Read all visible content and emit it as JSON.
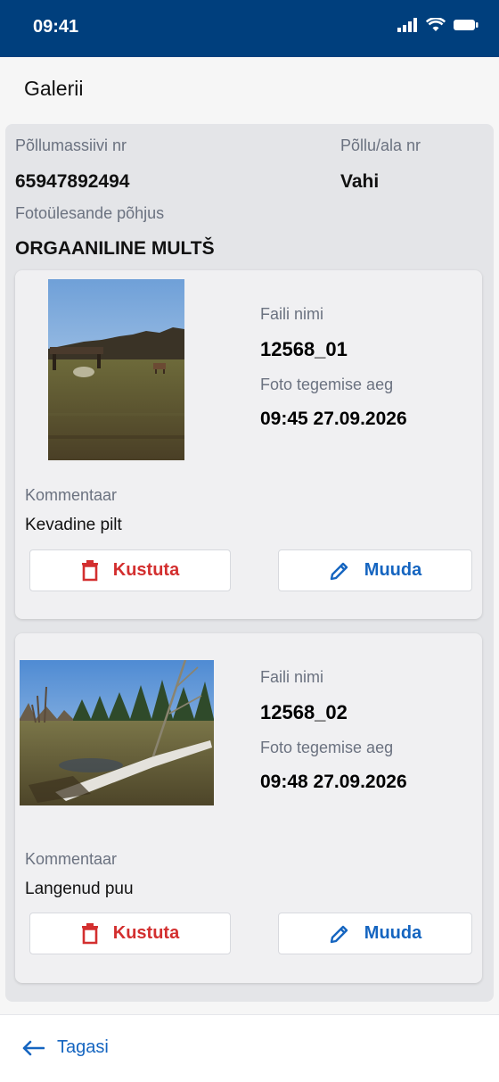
{
  "status": {
    "time": "09:41"
  },
  "header": {
    "title": "Galerii"
  },
  "field": {
    "field_no_label": "Põllumassiivi nr",
    "field_no": "65947892494",
    "area_label": "Põllu/ala nr",
    "area": "Vahi",
    "reason_label": "Fotoülesande põhjus",
    "reason": "ORGAANILINE MULTŠ"
  },
  "photos": [
    {
      "file_label": "Faili nimi",
      "file_name": "12568_01",
      "time_label": "Foto tegemise aeg",
      "time": "09:45 27.09.2026",
      "comment_label": "Kommentaar",
      "comment": "Kevadine pilt",
      "delete_label": "Kustuta",
      "edit_label": "Muuda"
    },
    {
      "file_label": "Faili nimi",
      "file_name": "12568_02",
      "time_label": "Foto tegemise aeg",
      "time": "09:48 27.09.2026",
      "comment_label": "Kommentaar",
      "comment": "Langenud puu",
      "delete_label": "Kustuta",
      "edit_label": "Muuda"
    }
  ],
  "footer": {
    "back_label": "Tagasi"
  },
  "colors": {
    "primary": "#003f7d",
    "danger": "#d32f2f",
    "link": "#1565c0"
  },
  "icons": {
    "delete": "trash-icon",
    "edit": "pencil-icon",
    "back": "arrow-left-icon"
  }
}
